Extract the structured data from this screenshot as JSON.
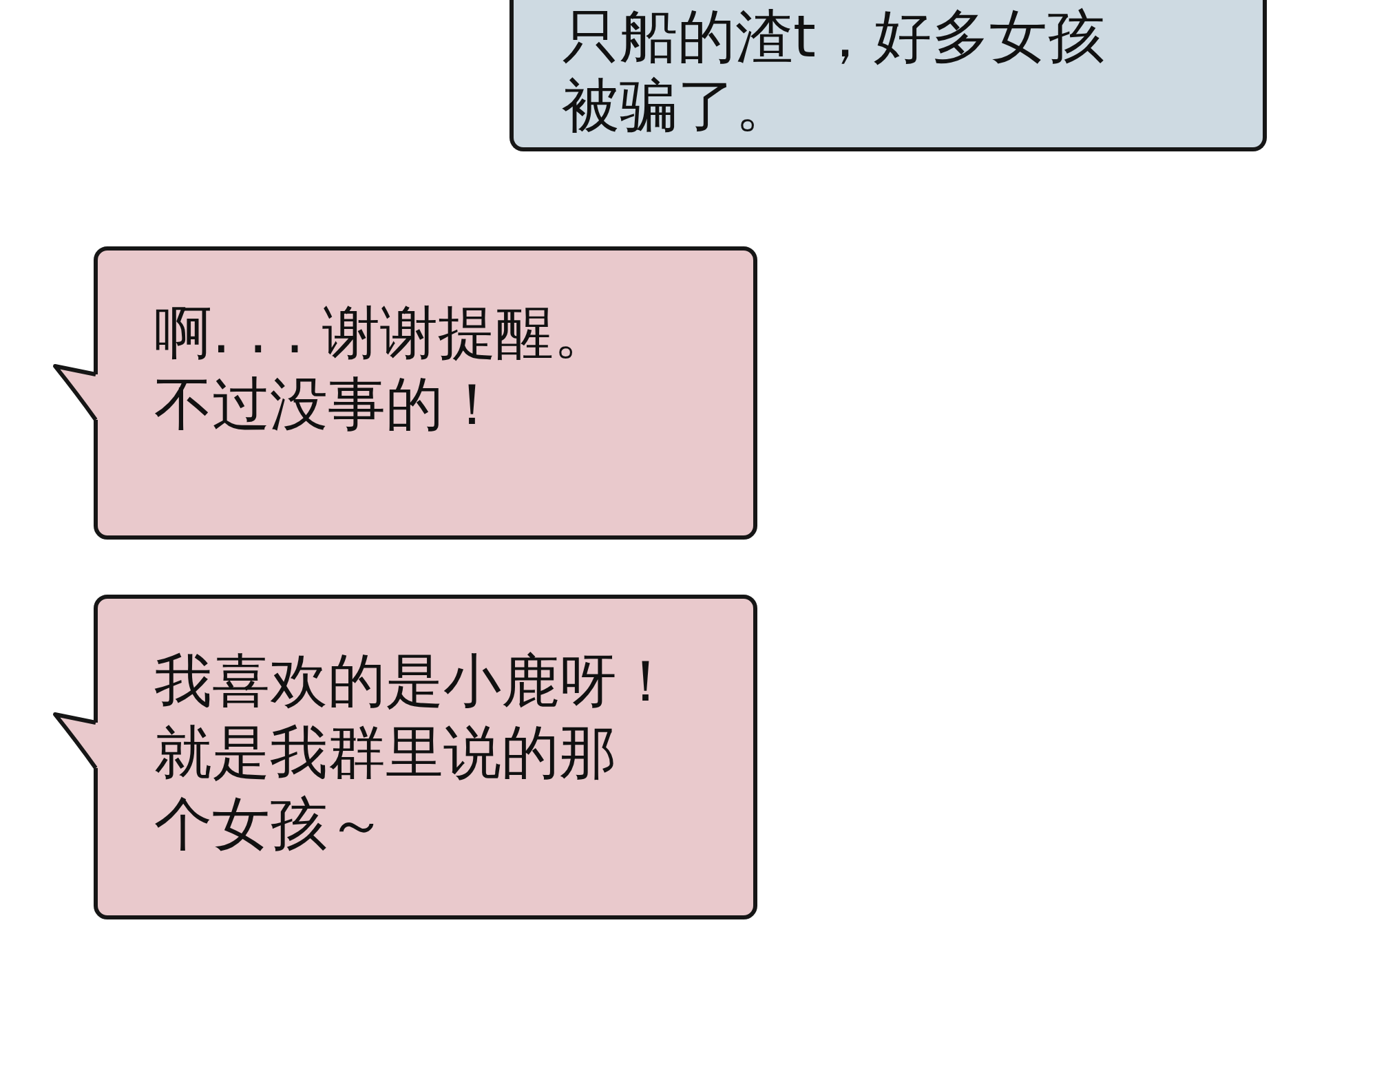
{
  "messages": [
    {
      "kind": "outgoing",
      "color": "#cedae2",
      "tail": false,
      "lines": [
        "只船的渣t，好多女孩",
        "被骗了。"
      ]
    },
    {
      "kind": "incoming",
      "color": "#e9c9cc",
      "tail": true,
      "lines": [
        "啊. . . 谢谢提醒。",
        "不过没事的！"
      ]
    },
    {
      "kind": "incoming",
      "color": "#e9c9cc",
      "tail": true,
      "lines": [
        "我喜欢的是小鹿呀！",
        "就是我群里说的那",
        "个女孩～"
      ]
    }
  ]
}
